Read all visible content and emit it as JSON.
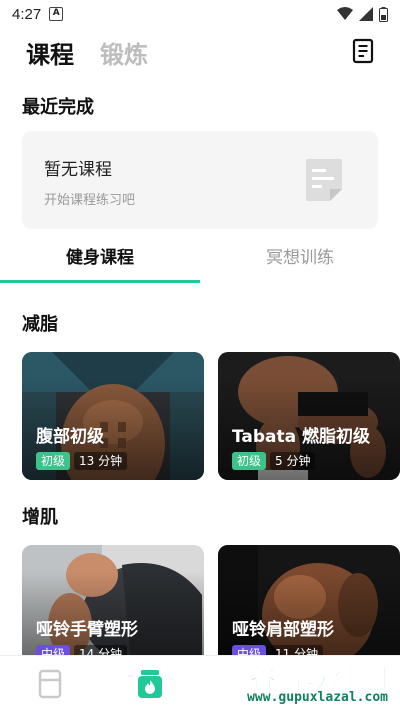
{
  "status": {
    "time": "4:27",
    "notif_icon": "A"
  },
  "header": {
    "tab_active": "课程",
    "tab_inactive": "锻炼"
  },
  "recent": {
    "title": "最近完成",
    "empty_title": "暂无课程",
    "empty_hint": "开始课程练习吧"
  },
  "segments": {
    "active": "健身课程",
    "inactive": "冥想训练",
    "accent": "#20c997"
  },
  "sections": [
    {
      "title": "减脂",
      "cards": [
        {
          "title": "腹部初级",
          "level": "初级",
          "duration": "13 分钟"
        },
        {
          "title": "Tabata 燃脂初级",
          "level": "初级",
          "duration": "5 分钟"
        }
      ]
    },
    {
      "title": "增肌",
      "cards": [
        {
          "title": "哑铃手臂塑形",
          "level": "中级",
          "duration": "14 分钟"
        },
        {
          "title": "哑铃肩部塑形",
          "level": "中级",
          "duration": "11 分钟"
        }
      ]
    }
  ],
  "colors": {
    "beginner": "#3cc28a",
    "intermediate": "#6b4fe0"
  },
  "watermark": {
    "name": "谷普软件园",
    "url": "www.gupuxlazal.com"
  }
}
